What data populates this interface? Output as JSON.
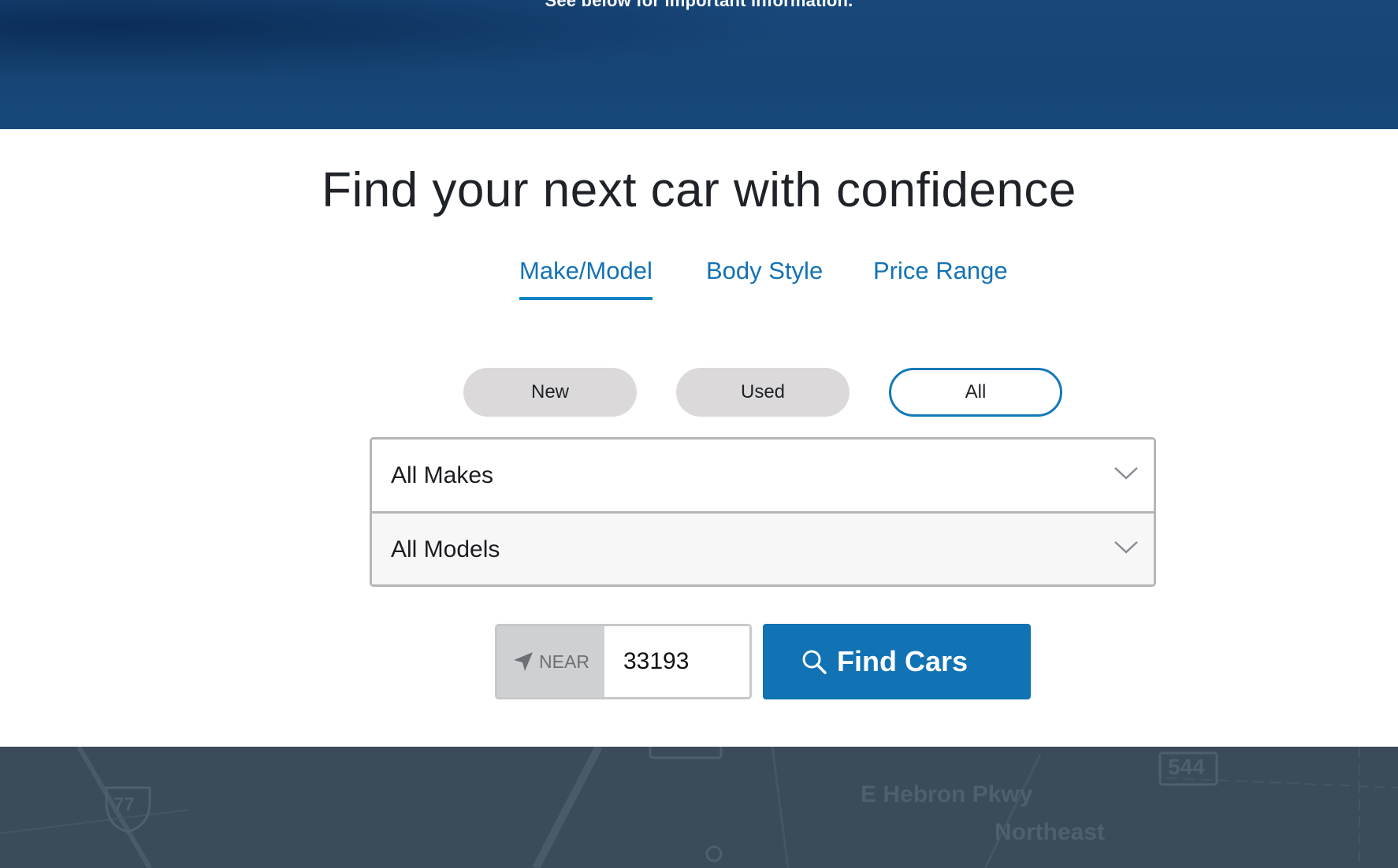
{
  "hero": {
    "notice": "See below for important information."
  },
  "page": {
    "title": "Find your next car with confidence"
  },
  "tabs": [
    {
      "label": "Make/Model",
      "active": true
    },
    {
      "label": "Body Style",
      "active": false
    },
    {
      "label": "Price Range",
      "active": false
    }
  ],
  "condition_filters": [
    {
      "label": "New",
      "selected": false
    },
    {
      "label": "Used",
      "selected": false
    },
    {
      "label": "All",
      "selected": true
    }
  ],
  "selects": {
    "makes": {
      "value": "All Makes",
      "icon": "chevron-down-icon"
    },
    "models": {
      "value": "All Models",
      "icon": "chevron-down-icon"
    }
  },
  "location": {
    "near_label": "NEAR",
    "near_icon": "location-arrow-icon",
    "zip_value": "33193"
  },
  "search": {
    "button_label": "Find Cars",
    "icon": "search-icon"
  },
  "map": {
    "labels": [
      "E Hebron Pkwy",
      "Northeast",
      "544",
      "77"
    ]
  },
  "colors": {
    "hero_blue": "#164575",
    "accent_blue": "#1472b5",
    "button_blue": "#1172b4",
    "pill_gray": "#dcd9db",
    "map_slate": "#3b4b5a"
  }
}
